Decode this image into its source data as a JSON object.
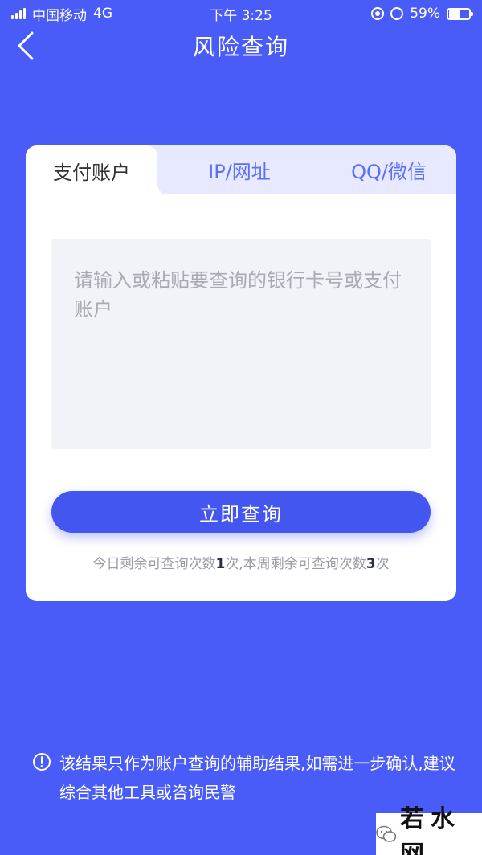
{
  "status_bar": {
    "carrier": "中国移动",
    "network": "4G",
    "time": "下午 3:25",
    "battery_percent_label": "59%",
    "battery_level": 0.59
  },
  "nav": {
    "title": "风险查询",
    "back_icon": "chevron-left-icon"
  },
  "tabs": [
    {
      "label": "支付账户",
      "active": true
    },
    {
      "label": "IP/网址",
      "active": false
    },
    {
      "label": "QQ/微信",
      "active": false
    }
  ],
  "query": {
    "value": "",
    "placeholder": "请输入或粘贴要查询的银行卡号或支付账户",
    "button_label": "立即查询"
  },
  "quota": {
    "daily_prefix": "今日剩余可查询次数",
    "daily_count": "1",
    "daily_suffix": "次,",
    "weekly_prefix": "本周剩余可查询次数",
    "weekly_count": "3",
    "weekly_suffix": "次"
  },
  "notice": {
    "icon": "info-circle-icon",
    "text": "该结果只作为账户查询的辅助结果,如需进一步确认,建议综合其他工具或咨询民警"
  },
  "watermark": {
    "text": "若水网"
  },
  "colors": {
    "background": "#4a5cf7",
    "button": "#4356f0",
    "tab_inactive_bg": "#e6e9ff",
    "tab_inactive_text": "#5b6ef8",
    "input_bg": "#f2f3f8"
  }
}
